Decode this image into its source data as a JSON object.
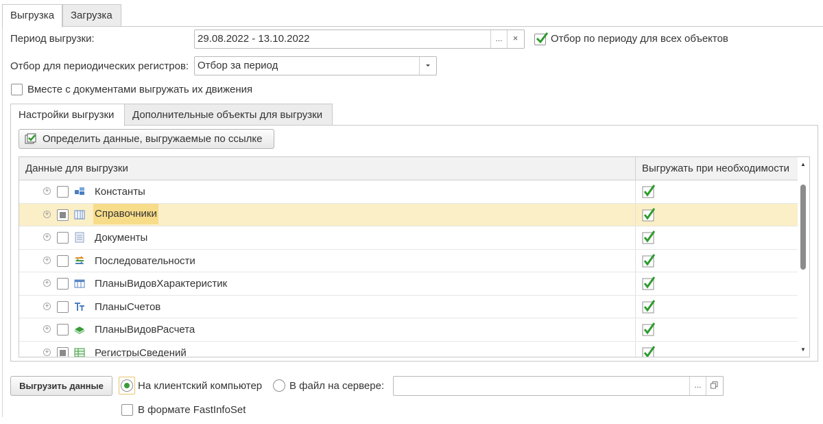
{
  "tabs": [
    {
      "label": "Выгрузка",
      "active": true
    },
    {
      "label": "Загрузка",
      "active": false
    }
  ],
  "period": {
    "label": "Период выгрузки:",
    "value": "29.08.2022 - 13.10.2022",
    "select_btn": "...",
    "clear_btn": "×",
    "filter_all_label": "Отбор по периоду для всех объектов",
    "filter_all_checked": true
  },
  "periodic_filter": {
    "label": "Отбор для периодических регистров:",
    "value": "Отбор за период"
  },
  "with_movements": {
    "label": "Вместе с документами выгружать их движения",
    "checked": false
  },
  "inner_tabs": [
    {
      "label": "Настройки выгрузки",
      "active": true
    },
    {
      "label": "Дополнительные объекты для выгрузки",
      "active": false
    }
  ],
  "define_button": "Определить данные, выгружаемые по ссылке",
  "grid": {
    "columns": [
      "Данные для выгрузки",
      "Выгружать при необходимости"
    ],
    "rows": [
      {
        "name": "Константы",
        "icon": "constants-icon",
        "checked": false,
        "partial": false,
        "export_if_needed": true,
        "selected": false
      },
      {
        "name": "Справочники",
        "icon": "catalogs-icon",
        "checked": false,
        "partial": true,
        "export_if_needed": true,
        "selected": true
      },
      {
        "name": "Документы",
        "icon": "documents-icon",
        "checked": false,
        "partial": false,
        "export_if_needed": true,
        "selected": false
      },
      {
        "name": "Последовательности",
        "icon": "sequences-icon",
        "checked": false,
        "partial": false,
        "export_if_needed": true,
        "selected": false
      },
      {
        "name": "ПланыВидовХарактеристик",
        "icon": "characteristic-types-icon",
        "checked": false,
        "partial": false,
        "export_if_needed": true,
        "selected": false
      },
      {
        "name": "ПланыСчетов",
        "icon": "chart-of-accounts-icon",
        "checked": false,
        "partial": false,
        "export_if_needed": true,
        "selected": false
      },
      {
        "name": "ПланыВидовРасчета",
        "icon": "calculation-types-icon",
        "checked": false,
        "partial": false,
        "export_if_needed": true,
        "selected": false
      },
      {
        "name": "РегистрыСведений",
        "icon": "info-registers-icon",
        "checked": false,
        "partial": true,
        "export_if_needed": true,
        "selected": false
      }
    ]
  },
  "export_button": "Выгрузить данные",
  "destination": {
    "client_label": "На клиентский компьютер",
    "server_label": "В файл на сервере:",
    "selected": "client",
    "server_path": "",
    "browse_btn": "...",
    "open_btn": "open"
  },
  "fastinfoset": {
    "label": "В формате FastInfoSet",
    "checked": false
  },
  "colors": {
    "selection": "#fbefc7",
    "selection_text": "#f7dc8a",
    "check_green": "#2e9b2e"
  }
}
